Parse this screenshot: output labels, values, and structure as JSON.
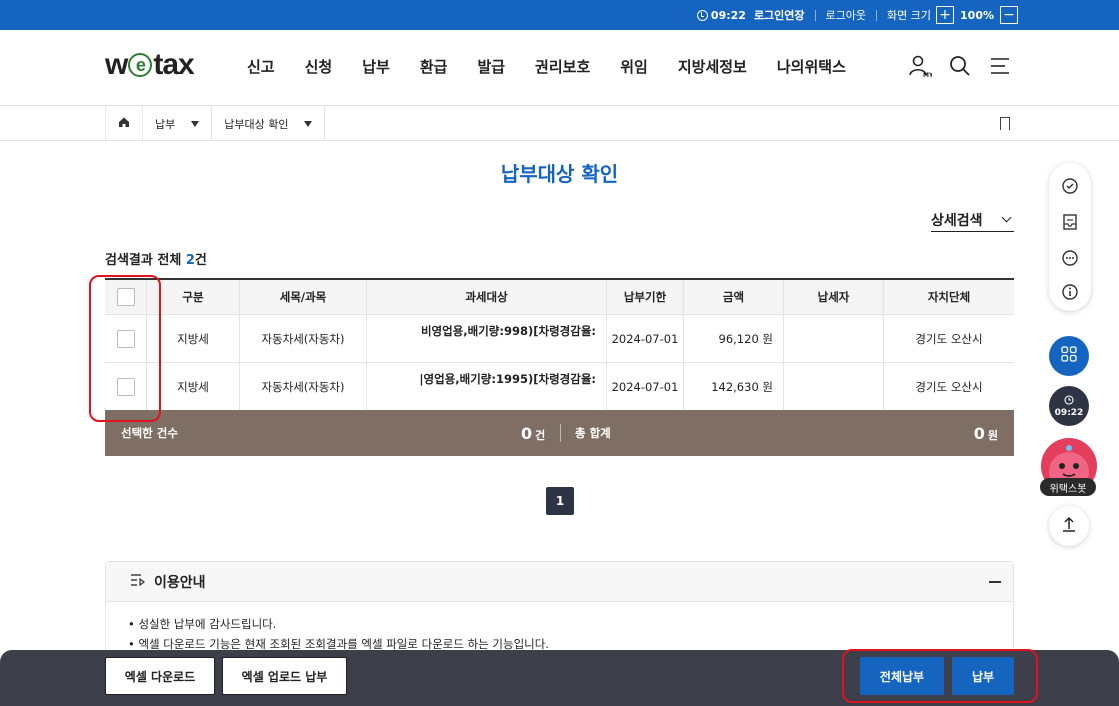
{
  "topbar": {
    "time": "09:22",
    "extend_label": "로그인연장",
    "logout_label": "로그아웃",
    "zoom_label": "화면 크기",
    "zoom_plus": "+",
    "zoom_value": "100%",
    "zoom_minus": "−"
  },
  "header": {
    "logo_left": "w",
    "logo_e": "e",
    "logo_right": "tax",
    "nav": [
      "신고",
      "신청",
      "납부",
      "환급",
      "발급",
      "권리보호",
      "위임",
      "지방세정보",
      "나의위택스"
    ],
    "my_label": "MY"
  },
  "breadcrumb": {
    "level1": "납부",
    "level2": "납부대상 확인"
  },
  "page": {
    "title": "납부대상 확인",
    "detail_search": "상세검색",
    "result_prefix": "검색결과 전체 ",
    "result_count": "2",
    "result_suffix": "건"
  },
  "table": {
    "headers": [
      "",
      "구분",
      "세목/과목",
      "과세대상",
      "납부기한",
      "금액",
      "납세자",
      "자치단체"
    ],
    "rows": [
      {
        "gubun": "지방세",
        "tax": "자동차세(자동차)",
        "object": "비영업용,배기량:998)[차령경감율:",
        "due": "2024-07-01",
        "amount": "96,120 원",
        "payer": "",
        "gov": "경기도 오산시"
      },
      {
        "gubun": "지방세",
        "tax": "자동차세(자동차)",
        "object": "|영업용,배기량:1995)[차령경감율:",
        "due": "2024-07-01",
        "amount": "142,630 원",
        "payer": "",
        "gov": "경기도 오산시"
      }
    ]
  },
  "summary": {
    "selected_label": "선택한 건수",
    "selected_value": "0",
    "selected_unit": "건",
    "total_label": "총 합계",
    "total_value": "0",
    "total_unit": "원"
  },
  "pagination": {
    "current": "1"
  },
  "info": {
    "title": "이용안내",
    "items": [
      "성실한 납부에 감사드립니다.",
      "엑셀 다운로드 기능은 현재 조회된 조회결과를 엑셀 파일로 다운로드 하는 기능입니다."
    ]
  },
  "footer": {
    "excel_download": "엑셀 다운로드",
    "excel_upload": "엑셀 업로드 납부",
    "pay_all": "전체납부",
    "pay": "납부"
  },
  "quickmenu": {
    "time": "09:22",
    "bot_label": "위택스봇"
  },
  "colors": {
    "brand_blue": "#1565c0",
    "summary_bar": "#7f6e63",
    "footer_bar": "#3d3f4a",
    "highlight_red": "#e0141e"
  }
}
